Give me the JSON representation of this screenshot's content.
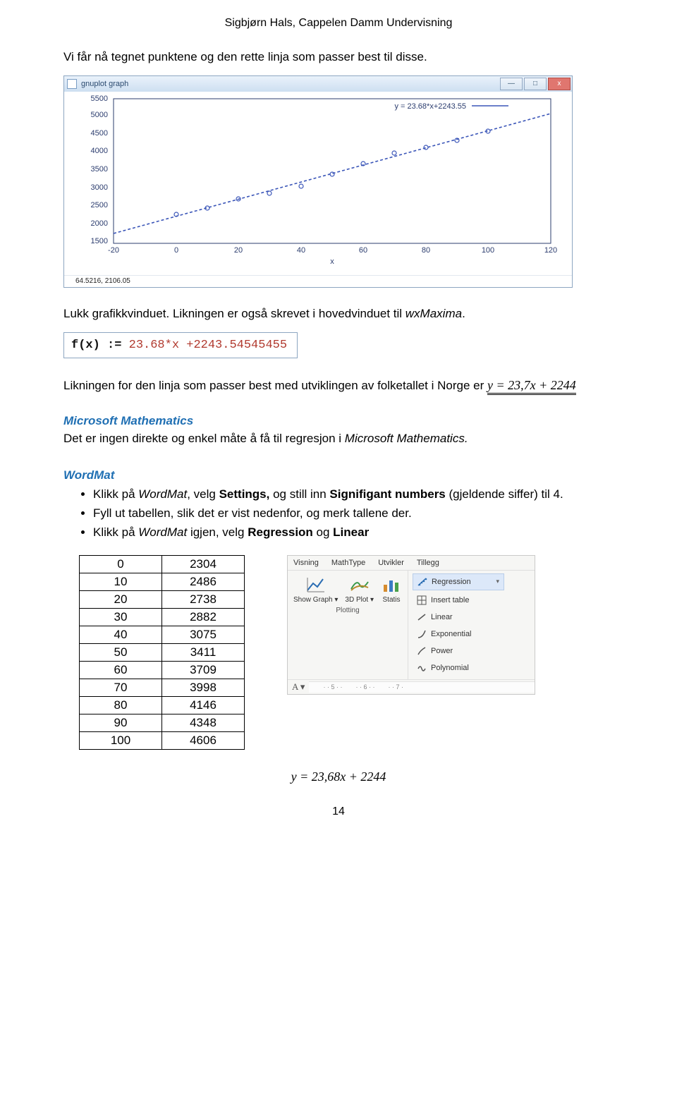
{
  "header_text": "Sigbjørn Hals, Cappelen Damm Undervisning",
  "intro_line": "Vi får nå tegnet punktene og den rette linja som passer best til disse.",
  "plot_window": {
    "title": "gnuplot graph",
    "status": "64.5216, 2106.05",
    "xlabel": "x",
    "legend": "y = 23.68*x+2243.55"
  },
  "after_plot_line_a": "Lukk grafikkvinduet. Likningen er også skrevet i hovedvinduet til ",
  "after_plot_line_b": "wxMaxima",
  "after_plot_line_c": ".",
  "code_line": {
    "prefix": "f(x) := ",
    "rest": "23.68*x +2243.54545455"
  },
  "eq_text_a": "Likningen for den linja som passer best med utviklingen av folketallet i Norge er ",
  "eq_formula": "y = 23,7x + 2244",
  "ms_heading": "Microsoft Mathematics",
  "ms_line_a": "Det er ingen direkte og enkel måte å få til regresjon i ",
  "ms_line_b": "Microsoft Mathematics.",
  "wordmat_heading": "WordMat",
  "bullets": {
    "b1_a": "Klikk på ",
    "b1_b": "WordMat",
    "b1_c": ", velg ",
    "b1_d": "Settings,",
    "b1_e": " og still inn ",
    "b1_f": "Signifigant numbers",
    "b1_g": " (gjeldende siffer) til 4.",
    "b2": "Fyll ut tabellen, slik det er vist nedenfor, og merk tallene der.",
    "b3_a": "Klikk på ",
    "b3_b": "WordMat",
    "b3_c": " igjen, velg ",
    "b3_d": "Regression",
    "b3_e": " og ",
    "b3_f": "Linear"
  },
  "table": {
    "rows": [
      {
        "x": "0",
        "y": "2304"
      },
      {
        "x": "10",
        "y": "2486"
      },
      {
        "x": "20",
        "y": "2738"
      },
      {
        "x": "30",
        "y": "2882"
      },
      {
        "x": "40",
        "y": "3075"
      },
      {
        "x": "50",
        "y": "3411"
      },
      {
        "x": "60",
        "y": "3709"
      },
      {
        "x": "70",
        "y": "3998"
      },
      {
        "x": "80",
        "y": "4146"
      },
      {
        "x": "90",
        "y": "4348"
      },
      {
        "x": "100",
        "y": "4606"
      }
    ]
  },
  "ribbon": {
    "tabs": [
      "Visning",
      "MathType",
      "Utvikler",
      "Tillegg"
    ],
    "buttons": [
      {
        "label": "Show Graph"
      },
      {
        "label": "3D Plot"
      },
      {
        "label": "Statis"
      }
    ],
    "group": "Plotting",
    "A": "A",
    "arrow": "▾",
    "dropdown_label": "Regression",
    "menu": [
      "Insert table",
      "Linear",
      "Exponential",
      "Power",
      "Polynomial"
    ],
    "ruler": [
      "5",
      "6",
      "7"
    ]
  },
  "result_eq": "y = 23,68x + 2244",
  "page_number": "14",
  "chart_data": {
    "type": "line",
    "title": "",
    "xlabel": "x",
    "ylabel": "",
    "xlim": [
      -20,
      120
    ],
    "ylim": [
      1500,
      5500
    ],
    "yticks": [
      1500,
      2000,
      2500,
      3000,
      3500,
      4000,
      4500,
      5000,
      5500
    ],
    "xticks": [
      -20,
      0,
      20,
      40,
      60,
      80,
      100,
      120
    ],
    "series": [
      {
        "name": "y = 23.68*x+2243.55",
        "type": "line",
        "x": [
          -20,
          120
        ],
        "y": [
          1770,
          5085
        ]
      },
      {
        "name": "points",
        "type": "scatter",
        "x": [
          0,
          10,
          20,
          30,
          40,
          50,
          60,
          70,
          80,
          90,
          100
        ],
        "y": [
          2304,
          2486,
          2738,
          2882,
          3075,
          3411,
          3709,
          3998,
          4146,
          4348,
          4606
        ]
      }
    ]
  }
}
